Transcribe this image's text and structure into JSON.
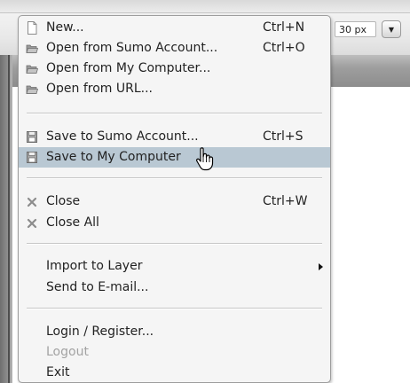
{
  "toolbar": {
    "size_value": "30 px",
    "size_button_icon": "triangle-down-icon"
  },
  "menu": {
    "items": [
      {
        "label": "New...",
        "shortcut": "Ctrl+N",
        "icon": "new-document-icon"
      },
      {
        "label": "Open from Sumo Account...",
        "shortcut": "Ctrl+O",
        "icon": "folder-open-icon"
      },
      {
        "label": "Open from My Computer...",
        "shortcut": "",
        "icon": "folder-open-icon"
      },
      {
        "label": "Open from URL...",
        "shortcut": "",
        "icon": "folder-open-icon"
      },
      {
        "label": "Save to Sumo Account...",
        "shortcut": "Ctrl+S",
        "icon": "floppy-disk-icon"
      },
      {
        "label": "Save to My Computer",
        "shortcut": "",
        "icon": "floppy-disk-icon",
        "highlighted": true
      },
      {
        "label": "Close",
        "shortcut": "Ctrl+W",
        "icon": "close-x-icon"
      },
      {
        "label": "Close All",
        "shortcut": "",
        "icon": "close-x-icon"
      },
      {
        "label": "Import to Layer",
        "shortcut": "",
        "icon": "",
        "submenu": true
      },
      {
        "label": "Send to E-mail...",
        "shortcut": "",
        "icon": ""
      },
      {
        "label": "Login / Register...",
        "shortcut": "",
        "icon": ""
      },
      {
        "label": "Logout",
        "shortcut": "",
        "icon": "",
        "disabled": true
      },
      {
        "label": "Exit",
        "shortcut": "",
        "icon": ""
      }
    ]
  },
  "cursor": {
    "icon": "hand-pointer-cursor-icon"
  }
}
